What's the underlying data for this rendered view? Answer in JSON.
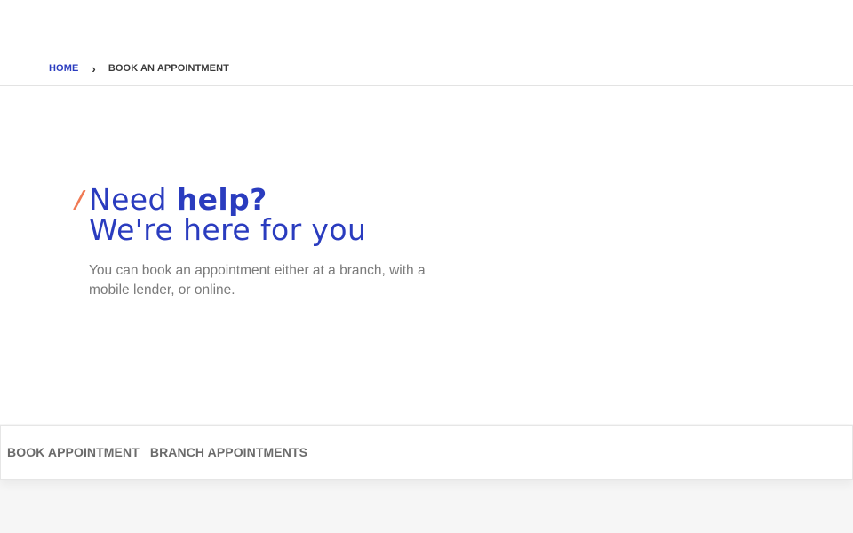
{
  "breadcrumb": {
    "home": "HOME",
    "separator": "›",
    "current": "BOOK AN APPOINTMENT"
  },
  "hero": {
    "headline_part1": "Need ",
    "headline_part2": "help?",
    "headline_line2": "We're here for you",
    "subtext": "You can book an appointment either at a branch, with a mobile lender, or online."
  },
  "tabs": [
    {
      "label": "BOOK APPOINTMENT"
    },
    {
      "label": "BRANCH APPOINTMENTS"
    }
  ],
  "colors": {
    "brand": "#2a3cbf",
    "accent": "#f07a54",
    "muted_text": "#7a7a7a"
  }
}
